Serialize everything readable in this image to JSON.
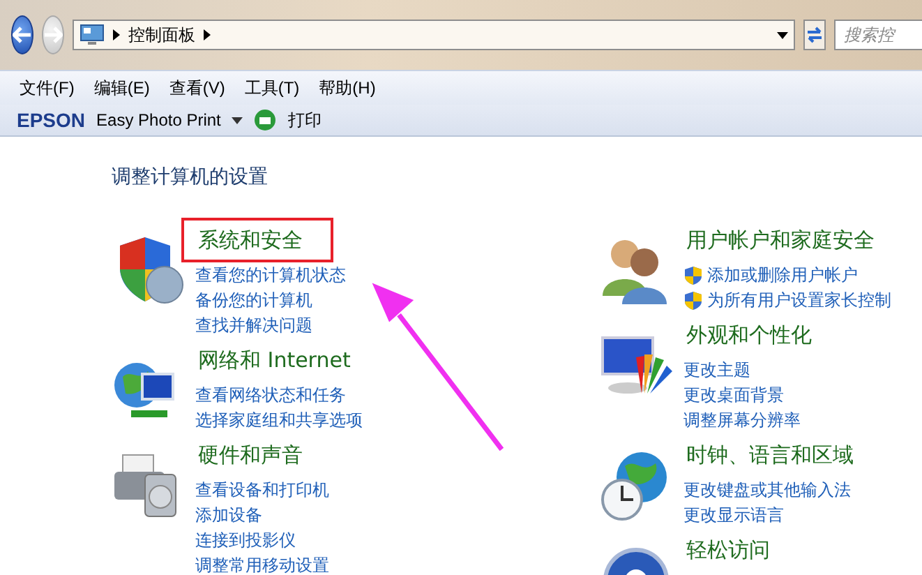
{
  "nav": {
    "breadcrumb": [
      "控制面板"
    ],
    "search": {
      "placeholder": "搜索控"
    }
  },
  "menu": [
    {
      "label": "文件(F)"
    },
    {
      "label": "编辑(E)"
    },
    {
      "label": "查看(V)"
    },
    {
      "label": "工具(T)"
    },
    {
      "label": "帮助(H)"
    }
  ],
  "toolbar": {
    "brand": "EPSON",
    "app": "Easy Photo Print",
    "print": "打印"
  },
  "heading": "调整计算机的设置",
  "columns": [
    [
      {
        "kind": "security",
        "title": "系统和安全",
        "highlighted": true,
        "links": [
          {
            "label": "查看您的计算机状态",
            "shield": false
          },
          {
            "label": "备份您的计算机",
            "shield": false
          },
          {
            "label": "查找并解决问题",
            "shield": false
          }
        ]
      },
      {
        "kind": "network",
        "title": "网络和 Internet",
        "highlighted": false,
        "links": [
          {
            "label": "查看网络状态和任务",
            "shield": false
          },
          {
            "label": "选择家庭组和共享选项",
            "shield": false
          }
        ]
      },
      {
        "kind": "hardware",
        "title": "硬件和声音",
        "highlighted": false,
        "links": [
          {
            "label": "查看设备和打印机",
            "shield": false
          },
          {
            "label": "添加设备",
            "shield": false
          },
          {
            "label": "连接到投影仪",
            "shield": false
          },
          {
            "label": "调整常用移动设置",
            "shield": false
          }
        ]
      }
    ],
    [
      {
        "kind": "users",
        "title": "用户帐户和家庭安全",
        "highlighted": false,
        "links": [
          {
            "label": "添加或删除用户帐户",
            "shield": true
          },
          {
            "label": "为所有用户设置家长控制",
            "shield": true
          }
        ]
      },
      {
        "kind": "appearance",
        "title": "外观和个性化",
        "highlighted": false,
        "links": [
          {
            "label": "更改主题",
            "shield": false
          },
          {
            "label": "更改桌面背景",
            "shield": false
          },
          {
            "label": "调整屏幕分辨率",
            "shield": false
          }
        ]
      },
      {
        "kind": "clock",
        "title": "时钟、语言和区域",
        "highlighted": false,
        "links": [
          {
            "label": "更改键盘或其他输入法",
            "shield": false
          },
          {
            "label": "更改显示语言",
            "shield": false
          }
        ]
      },
      {
        "kind": "access",
        "title": "轻松访问",
        "highlighted": false
      }
    ]
  ]
}
